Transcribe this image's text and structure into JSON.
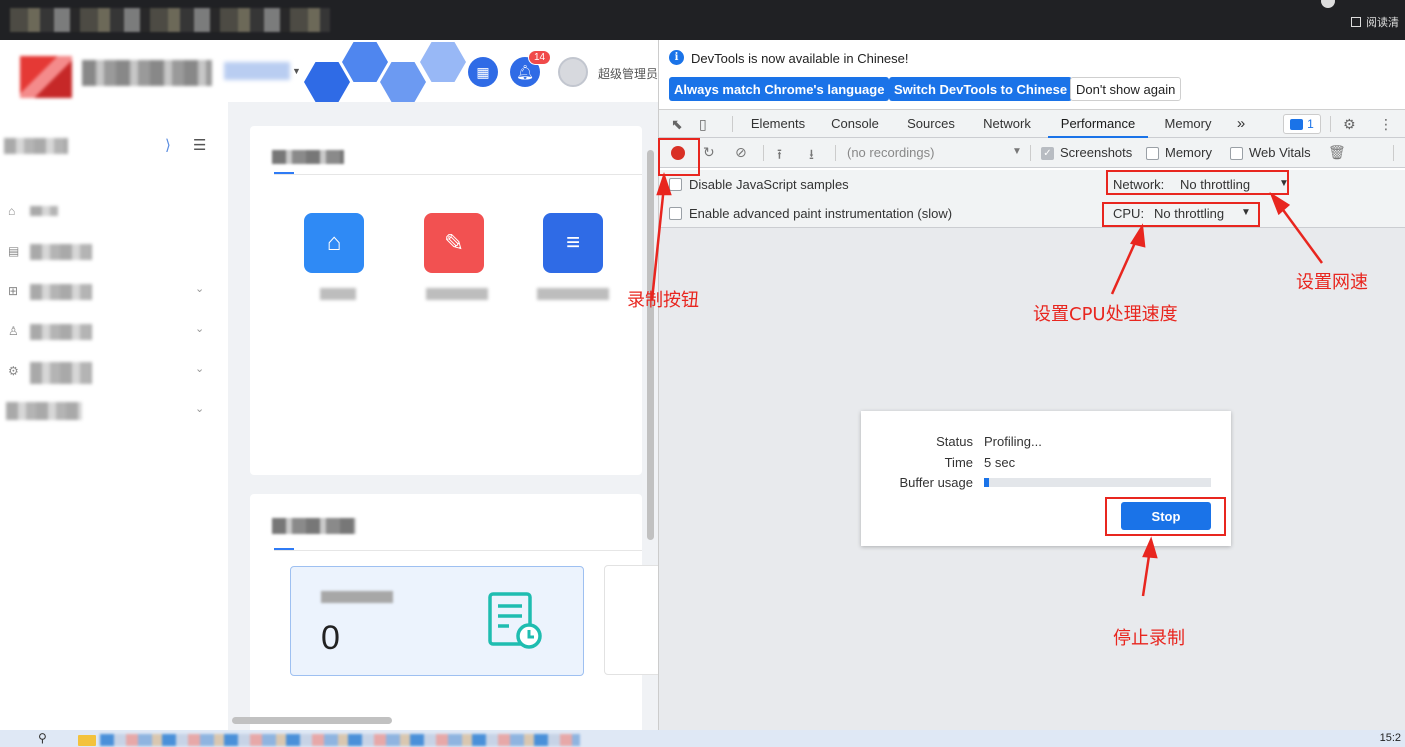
{
  "webpage": {
    "notification_count": "14",
    "admin_label": "超级管理员",
    "stat_value": "0"
  },
  "devtools": {
    "info_message": "DevTools is now available in Chinese!",
    "buttons": {
      "always_match": "Always match Chrome's language",
      "switch": "Switch DevTools to Chinese",
      "dont_show": "Don't show again"
    },
    "tabs": [
      "Elements",
      "Console",
      "Sources",
      "Network",
      "Performance",
      "Memory"
    ],
    "active_tab": "Performance",
    "overflow_glyph": "»",
    "issues_count": "1",
    "toolbar": {
      "recordings": "(no recordings)",
      "screenshots_label": "Screenshots",
      "screenshots_checked": true,
      "memory_label": "Memory",
      "web_vitals_label": "Web Vitals"
    },
    "settings": {
      "disable_js_samples": "Disable JavaScript samples",
      "advanced_paint": "Enable advanced paint instrumentation (slow)",
      "network_label": "Network:",
      "network_value": "No throttling",
      "cpu_label": "CPU:",
      "cpu_value": "No throttling"
    },
    "status": {
      "status_key": "Status",
      "status_value": "Profiling...",
      "time_key": "Time",
      "time_value": "5 sec",
      "buffer_key": "Buffer usage",
      "buffer_fraction": 0.02,
      "stop_label": "Stop"
    }
  },
  "annotations": {
    "record_button": "录制按钮",
    "network_speed": "设置网速",
    "cpu_speed": "设置CPU处理速度",
    "stop_recording": "停止录制",
    "color": "#e8261f"
  },
  "taskbar": {
    "clock": "15:2"
  },
  "browser": {
    "reading_mode": "阅读清"
  },
  "colors": {
    "accent": "#1a73e8",
    "record": "#d93025",
    "annotation": "#e8261f"
  }
}
